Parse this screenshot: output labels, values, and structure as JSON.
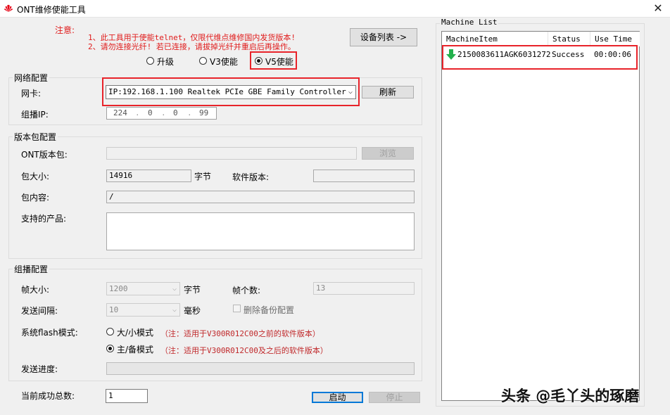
{
  "window": {
    "title": "ONT维修使能工具",
    "close_glyph": "✕"
  },
  "notes": {
    "label": "注意:",
    "line1": "1、此工具用于使能telnet，仅限代维点维修国内发货版本!",
    "line2": "2、请勿连接光纤! 若已连接，请拔掉光纤并重启后再操作。"
  },
  "device_list_button": "设备列表 ->",
  "mode": {
    "options": [
      "升级",
      "V3使能",
      "V5使能"
    ],
    "selected": "V5使能"
  },
  "network": {
    "group_title": "网络配置",
    "nic_label": "网卡:",
    "nic_value": "IP:192.168.1.100 Realtek PCIe GBE Family Controller",
    "refresh_button": "刷新",
    "multicast_label": "组播IP:",
    "multicast_ip": [
      "224",
      "0",
      "0",
      "99"
    ]
  },
  "package": {
    "group_title": "版本包配置",
    "ont_pkg_label": "ONT版本包:",
    "ont_pkg_value": "",
    "browse_button": "浏览",
    "size_label": "包大小:",
    "size_value": "14916",
    "size_unit": "字节",
    "sw_version_label": "软件版本:",
    "sw_version_value": "",
    "content_label": "包内容:",
    "content_value": "/",
    "products_label": "支持的产品:",
    "products_value": ""
  },
  "multicast": {
    "group_title": "组播配置",
    "frame_size_label": "帧大小:",
    "frame_size_value": "1200",
    "frame_size_unit": "字节",
    "frame_count_label": "帧个数:",
    "frame_count_value": "13",
    "interval_label": "发送间隔:",
    "interval_value": "10",
    "interval_unit": "毫秒",
    "delete_backup_label": "删除备份配置",
    "flash_mode_label": "系统flash模式:",
    "flash_options": [
      {
        "label": "大/小模式",
        "hint": "（注：适用于V300R012C00之前的软件版本）",
        "checked": false
      },
      {
        "label": "主/备模式",
        "hint": "（注：适用于V300R012C00及之后的软件版本）",
        "checked": true
      }
    ],
    "progress_label": "发送进度:",
    "progress": 0
  },
  "footer": {
    "success_total_label": "当前成功总数:",
    "success_total_value": "1",
    "start_button": "启动",
    "stop_button": "停止"
  },
  "machine_list": {
    "title": "Machine List",
    "columns": [
      "MachineItem",
      "Status",
      "Use Time"
    ],
    "rows": [
      {
        "item": "2150083611AGK6031272",
        "status": "Success",
        "use_time": "00:00:06",
        "icon": "green-down-arrow-icon"
      }
    ]
  },
  "watermark": "头条 @毛丫头的琢磨",
  "colors": {
    "highlight_box": "#e8232a",
    "note_text": "#e01b1b",
    "success_icon": "#22b14c"
  }
}
